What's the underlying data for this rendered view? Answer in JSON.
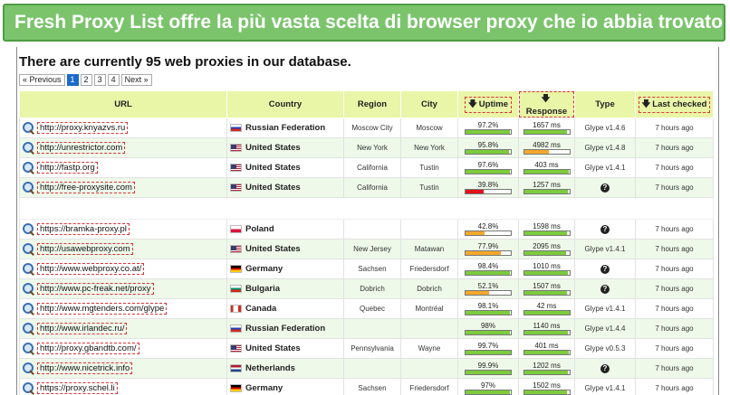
{
  "banner": "Fresh Proxy List offre la più vasta scelta di browser proxy che io abbia trovato",
  "heading": "There are currently 95 web proxies in our database.",
  "pager": {
    "prev": "« Previous",
    "pages": [
      "1",
      "2",
      "3",
      "4"
    ],
    "next": "Next »",
    "current": "1"
  },
  "columns": {
    "url": "URL",
    "country": "Country",
    "region": "Region",
    "city": "City",
    "uptime": "Uptime",
    "response": "Response",
    "type": "Type",
    "last_checked": "Last checked"
  },
  "colors": {
    "green": "#7ccc3c",
    "orange": "#f4a82a",
    "red": "#e3131b",
    "banner": "#7bc46c"
  },
  "rows_top": [
    {
      "url": "http://proxy.knyazvs.ru",
      "country": "Russian Federation",
      "flag": "ru",
      "region": "Moscow City",
      "city": "Moscow",
      "uptime": "97.2%",
      "uptime_frac": 0.972,
      "uptime_color": "green",
      "response": "1657 ms",
      "resp_frac": 0.95,
      "resp_color": "green",
      "type": "Glype v1.4.6",
      "type_icon": false,
      "checked": "7 hours ago"
    },
    {
      "url": "http://unrestrictor.com",
      "country": "United States",
      "flag": "us",
      "region": "New York",
      "city": "New York",
      "uptime": "95.8%",
      "uptime_frac": 0.958,
      "uptime_color": "green",
      "response": "4982 ms",
      "resp_frac": 0.55,
      "resp_color": "orange",
      "type": "Glype v1.4.8",
      "type_icon": false,
      "checked": "7 hours ago"
    },
    {
      "url": "http://fastp.org",
      "country": "United States",
      "flag": "us",
      "region": "California",
      "city": "Tustin",
      "uptime": "97.6%",
      "uptime_frac": 0.976,
      "uptime_color": "green",
      "response": "403 ms",
      "resp_frac": 0.98,
      "resp_color": "green",
      "type": "Glype v1.4.1",
      "type_icon": false,
      "checked": "7 hours ago"
    },
    {
      "url": "http://free-proxysite.com",
      "country": "United States",
      "flag": "us",
      "region": "California",
      "city": "Tustin",
      "uptime": "39.8%",
      "uptime_frac": 0.398,
      "uptime_color": "red",
      "response": "1257 ms",
      "resp_frac": 0.96,
      "resp_color": "green",
      "type": "",
      "type_icon": true,
      "checked": "7 hours ago"
    }
  ],
  "rows_bottom": [
    {
      "url": "https://bramka-proxy.pl",
      "country": "Poland",
      "flag": "pl",
      "region": "",
      "city": "",
      "uptime": "42.8%",
      "uptime_frac": 0.428,
      "uptime_color": "orange",
      "response": "1598 ms",
      "resp_frac": 0.95,
      "resp_color": "green",
      "type": "",
      "type_icon": true,
      "checked": "7 hours ago"
    },
    {
      "url": "http://usawebproxy.com",
      "country": "United States",
      "flag": "us",
      "region": "New Jersey",
      "city": "Matawan",
      "uptime": "77.9%",
      "uptime_frac": 0.779,
      "uptime_color": "orange",
      "response": "2095 ms",
      "resp_frac": 0.93,
      "resp_color": "green",
      "type": "Glype v1.4.1",
      "type_icon": false,
      "checked": "7 hours ago"
    },
    {
      "url": "http://www.webproxy.co.at/",
      "country": "Germany",
      "flag": "de",
      "region": "Sachsen",
      "city": "Friedersdorf",
      "uptime": "98.4%",
      "uptime_frac": 0.984,
      "uptime_color": "green",
      "response": "1010 ms",
      "resp_frac": 0.96,
      "resp_color": "green",
      "type": "",
      "type_icon": true,
      "checked": "7 hours ago"
    },
    {
      "url": "http://www.pc-freak.net/proxy",
      "country": "Bulgaria",
      "flag": "bg",
      "region": "Dobrich",
      "city": "Dobrich",
      "uptime": "52.1%",
      "uptime_frac": 0.521,
      "uptime_color": "orange",
      "response": "1507 ms",
      "resp_frac": 0.95,
      "resp_color": "green",
      "type": "",
      "type_icon": true,
      "checked": "7 hours ago"
    },
    {
      "url": "http://www.mgtenders.com/glype",
      "country": "Canada",
      "flag": "ca",
      "region": "Quebec",
      "city": "Montréal",
      "uptime": "98.1%",
      "uptime_frac": 0.981,
      "uptime_color": "green",
      "response": "42 ms",
      "resp_frac": 1.0,
      "resp_color": "green",
      "type": "Glype v1.4.1",
      "type_icon": false,
      "checked": "7 hours ago"
    },
    {
      "url": "http://www.irlandec.ru/",
      "country": "Russian Federation",
      "flag": "ru",
      "region": "",
      "city": "",
      "uptime": "98%",
      "uptime_frac": 0.98,
      "uptime_color": "green",
      "response": "1140 ms",
      "resp_frac": 0.96,
      "resp_color": "green",
      "type": "Glype v1.4.4",
      "type_icon": false,
      "checked": "7 hours ago"
    },
    {
      "url": "http://proxy.gbandtb.com/",
      "country": "United States",
      "flag": "us",
      "region": "Pennsylvania",
      "city": "Wayne",
      "uptime": "99.7%",
      "uptime_frac": 0.997,
      "uptime_color": "green",
      "response": "401 ms",
      "resp_frac": 0.98,
      "resp_color": "green",
      "type": "Glype v0.5.3",
      "type_icon": false,
      "checked": "7 hours ago"
    },
    {
      "url": "http://www.nicetrick.info",
      "country": "Netherlands",
      "flag": "nl",
      "region": "",
      "city": "",
      "uptime": "99.9%",
      "uptime_frac": 0.999,
      "uptime_color": "green",
      "response": "1202 ms",
      "resp_frac": 0.96,
      "resp_color": "green",
      "type": "",
      "type_icon": true,
      "checked": "7 hours ago"
    },
    {
      "url": "https://proxy.schel.li",
      "country": "Germany",
      "flag": "de",
      "region": "Sachsen",
      "city": "Friedersdorf",
      "uptime": "97%",
      "uptime_frac": 0.97,
      "uptime_color": "green",
      "response": "1502 ms",
      "resp_frac": 0.95,
      "resp_color": "green",
      "type": "Glype v1.4.1",
      "type_icon": false,
      "checked": "7 hours ago"
    }
  ]
}
